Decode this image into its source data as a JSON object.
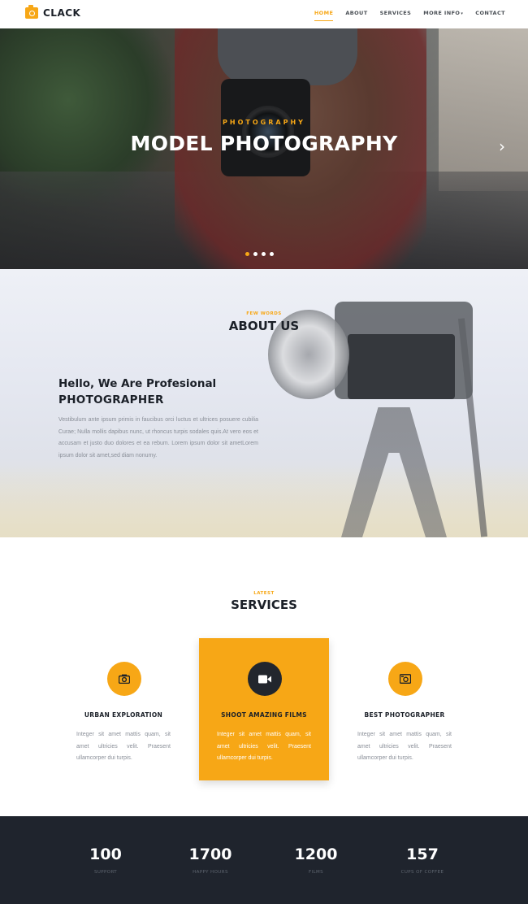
{
  "brand": {
    "name": "CLACK",
    "icon": "camera-icon",
    "accent": "#f7a716",
    "dark": "#1f242d"
  },
  "nav": {
    "items": [
      {
        "label": "HOME",
        "active": true
      },
      {
        "label": "ABOUT"
      },
      {
        "label": "SERVICES"
      },
      {
        "label": "MORE INFO"
      },
      {
        "label": "CONTACT"
      }
    ]
  },
  "hero": {
    "subtitle": "PHOTOGRAPHY",
    "title": "MODEL PHOTOGRAPHY",
    "next_icon": "chevron-right-icon",
    "slides_total": 4,
    "slide_active": 1
  },
  "about": {
    "kicker": "FEW WORDS",
    "title": "ABOUT US",
    "heading_line1": "Hello, We Are Profesional",
    "heading_line2": "PHOTOGRAPHER",
    "body": "Vestibulum ante ipsum primis in faucibus orci luctus et ultrices posuere cubilia Curae; Nulla mollis dapibus nunc, ut rhoncus turpis sodales quis.At vero eos et accusam et justo duo dolores et ea rebum. Lorem ipsum dolor sit ametLorem ipsum dolor sit amet,sed diam nonumy."
  },
  "services": {
    "kicker": "LATEST",
    "title": "SERVICES",
    "items": [
      {
        "title": "URBAN EXPLORATION",
        "icon": "camera-icon",
        "text": "Integer sit amet mattis quam, sit amet ultricies velit. Praesent ullamcorper dui turpis."
      },
      {
        "title": "SHOOT AMAZING FILMS",
        "icon": "video-camera-icon",
        "text": "Integer sit amet mattis quam, sit amet ultricies velit. Praesent ullamcorper dui turpis.",
        "featured": true
      },
      {
        "title": "BEST PHOTOGRAPHER",
        "icon": "photo-camera-icon",
        "text": "Integer sit amet mattis quam, sit amet ultricies velit. Praesent ullamcorper dui turpis."
      }
    ]
  },
  "stats": [
    {
      "value": "100",
      "label": "SUPPORT"
    },
    {
      "value": "1700",
      "label": "HAPPY HOURS"
    },
    {
      "value": "1200",
      "label": "FILMS"
    },
    {
      "value": "157",
      "label": "CUPS OF COFFEE"
    }
  ]
}
